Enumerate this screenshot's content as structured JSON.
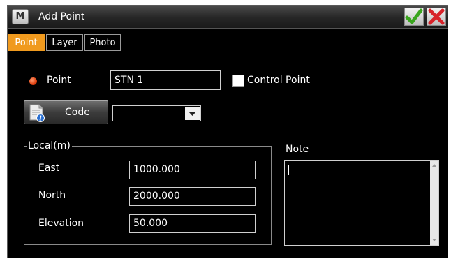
{
  "window": {
    "title": "Add Point",
    "app_icon_letter": "M",
    "ok_icon": "checkmark-icon",
    "cancel_icon": "close-icon"
  },
  "tabs": [
    {
      "label": "Point",
      "active": true
    },
    {
      "label": "Layer",
      "active": false
    },
    {
      "label": "Photo",
      "active": false
    }
  ],
  "point": {
    "label": "Point",
    "value": "STN 1",
    "control_point_label": "Control Point",
    "control_point_checked": false
  },
  "code": {
    "button_label": "Code",
    "value": ""
  },
  "local": {
    "legend": "Local(m)",
    "east_label": "East",
    "east_value": "1000.000",
    "north_label": "North",
    "north_value": "2000.000",
    "elevation_label": "Elevation",
    "elevation_value": "50.000"
  },
  "note": {
    "label": "Note",
    "value": ""
  },
  "colors": {
    "active_tab": "#f09a1e",
    "point_dot": "#e0400f",
    "ok_green": "#3aa51e",
    "cancel_red": "#d8232a"
  }
}
